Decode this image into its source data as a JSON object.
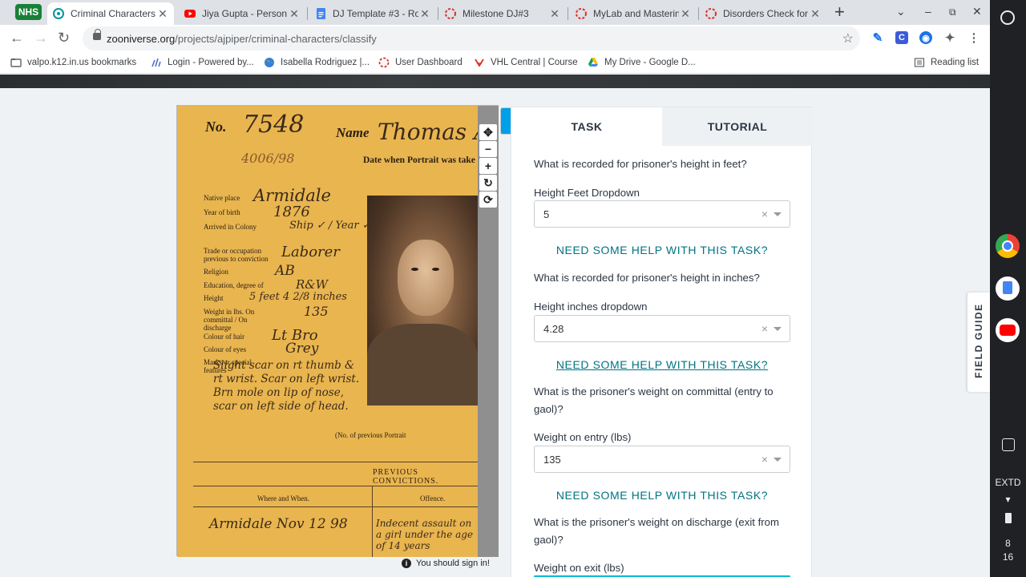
{
  "browser": {
    "tabs": [
      {
        "label": "NHS",
        "favicon": "nhs-badge"
      },
      {
        "label": "Criminal Characters",
        "favicon": "zooniverse-icon",
        "active": true
      },
      {
        "label": "Jiya Gupta - Person",
        "favicon": "youtube-icon"
      },
      {
        "label": "DJ Template #3 - Ro",
        "favicon": "google-docs-icon"
      },
      {
        "label": "Milestone DJ#3",
        "favicon": "loading-icon"
      },
      {
        "label": "MyLab and Masterin",
        "favicon": "loading-icon"
      },
      {
        "label": "Disorders Check for",
        "favicon": "loading-icon"
      }
    ],
    "url": {
      "host": "zooniverse.org",
      "path": "/projects/ajpiper/criminal-characters/classify"
    },
    "bookmarks": [
      {
        "label": "valpo.k12.in.us bookmarks",
        "icon": "folder-icon"
      },
      {
        "label": "Login - Powered by...",
        "icon": "login-icon"
      },
      {
        "label": "Isabella Rodriguez |...",
        "icon": "globe-icon"
      },
      {
        "label": "User Dashboard",
        "icon": "loading-icon"
      },
      {
        "label": "VHL Central | Course",
        "icon": "vhl-icon"
      },
      {
        "label": "My Drive - Google D...",
        "icon": "drive-icon"
      }
    ],
    "reading_list": "Reading list",
    "extensions": [
      {
        "label": "C",
        "color": "#3b5bdb"
      },
      {
        "label": "◉",
        "color": "#1a73e8"
      }
    ]
  },
  "record_card": {
    "no_label": "No.",
    "number": "7548",
    "name_label": "Name",
    "name": "Thomas A",
    "date_label": "Date when Portrait was take",
    "side_number": "4006/98",
    "fields": [
      {
        "label": "Native place",
        "value": "Armidale"
      },
      {
        "label": "Year of birth",
        "value": "1876"
      },
      {
        "label": "Arrived in Colony",
        "value": "Ship ✓ / Year ✓"
      },
      {
        "label": "Trade or occupation previous to conviction",
        "value": "Laborer"
      },
      {
        "label": "Religion",
        "value": "AB"
      },
      {
        "label": "Education, degree of",
        "value": "R&W"
      },
      {
        "label": "Height",
        "value": "5 feet 4 2/8 inches"
      },
      {
        "label": "Weight in lbs. On committal / On discharge",
        "value": "135"
      },
      {
        "label": "Colour of hair",
        "value": "Lt Bro"
      },
      {
        "label": "Colour of eyes",
        "value": "Grey"
      },
      {
        "label": "Marks or special features",
        "value": "Slight scar on rt thumb & rt wrist. Scar on left wrist. Brn mole on lip of nose, scar on left side of head."
      }
    ],
    "previous_portrait": "(No. of previous Portrait",
    "previous_convictions": "PREVIOUS CONVICTIONS.",
    "col_where": "Where and When.",
    "col_offence": "Offence.",
    "row_where": "Armidale Nov 12 98",
    "row_offence": "Indecent assault on a girl under the age of 14 years"
  },
  "tools": [
    "pointer-icon",
    "pan-icon",
    "zoom-out-icon",
    "zoom-in-icon",
    "rotate-icon",
    "reset-icon"
  ],
  "signin_notice": "You should sign in!",
  "task_panel": {
    "tab_task": "TASK",
    "tab_tutorial": "TUTORIAL",
    "help_text": "NEED SOME HELP WITH THIS TASK?",
    "questions": [
      {
        "question": "What is recorded for prisoner's height in feet?",
        "field_label": "Height Feet Dropdown",
        "value": "5"
      },
      {
        "question": "What is recorded for prisoner's height in inches?",
        "field_label": "Height inches dropdown",
        "value": "4.28"
      },
      {
        "question": "What is the prisoner's weight on committal (entry to gaol)?",
        "field_label": "Weight on entry (lbs)",
        "value": "135"
      },
      {
        "question": "What is the prisoner's weight on discharge (exit from gaol)?",
        "field_label": "Weight on exit (lbs)",
        "value": ""
      }
    ]
  },
  "field_guide": "FIELD GUIDE",
  "shelf": {
    "display_label": "EXTD",
    "time_hour": "8",
    "time_min": "16"
  }
}
